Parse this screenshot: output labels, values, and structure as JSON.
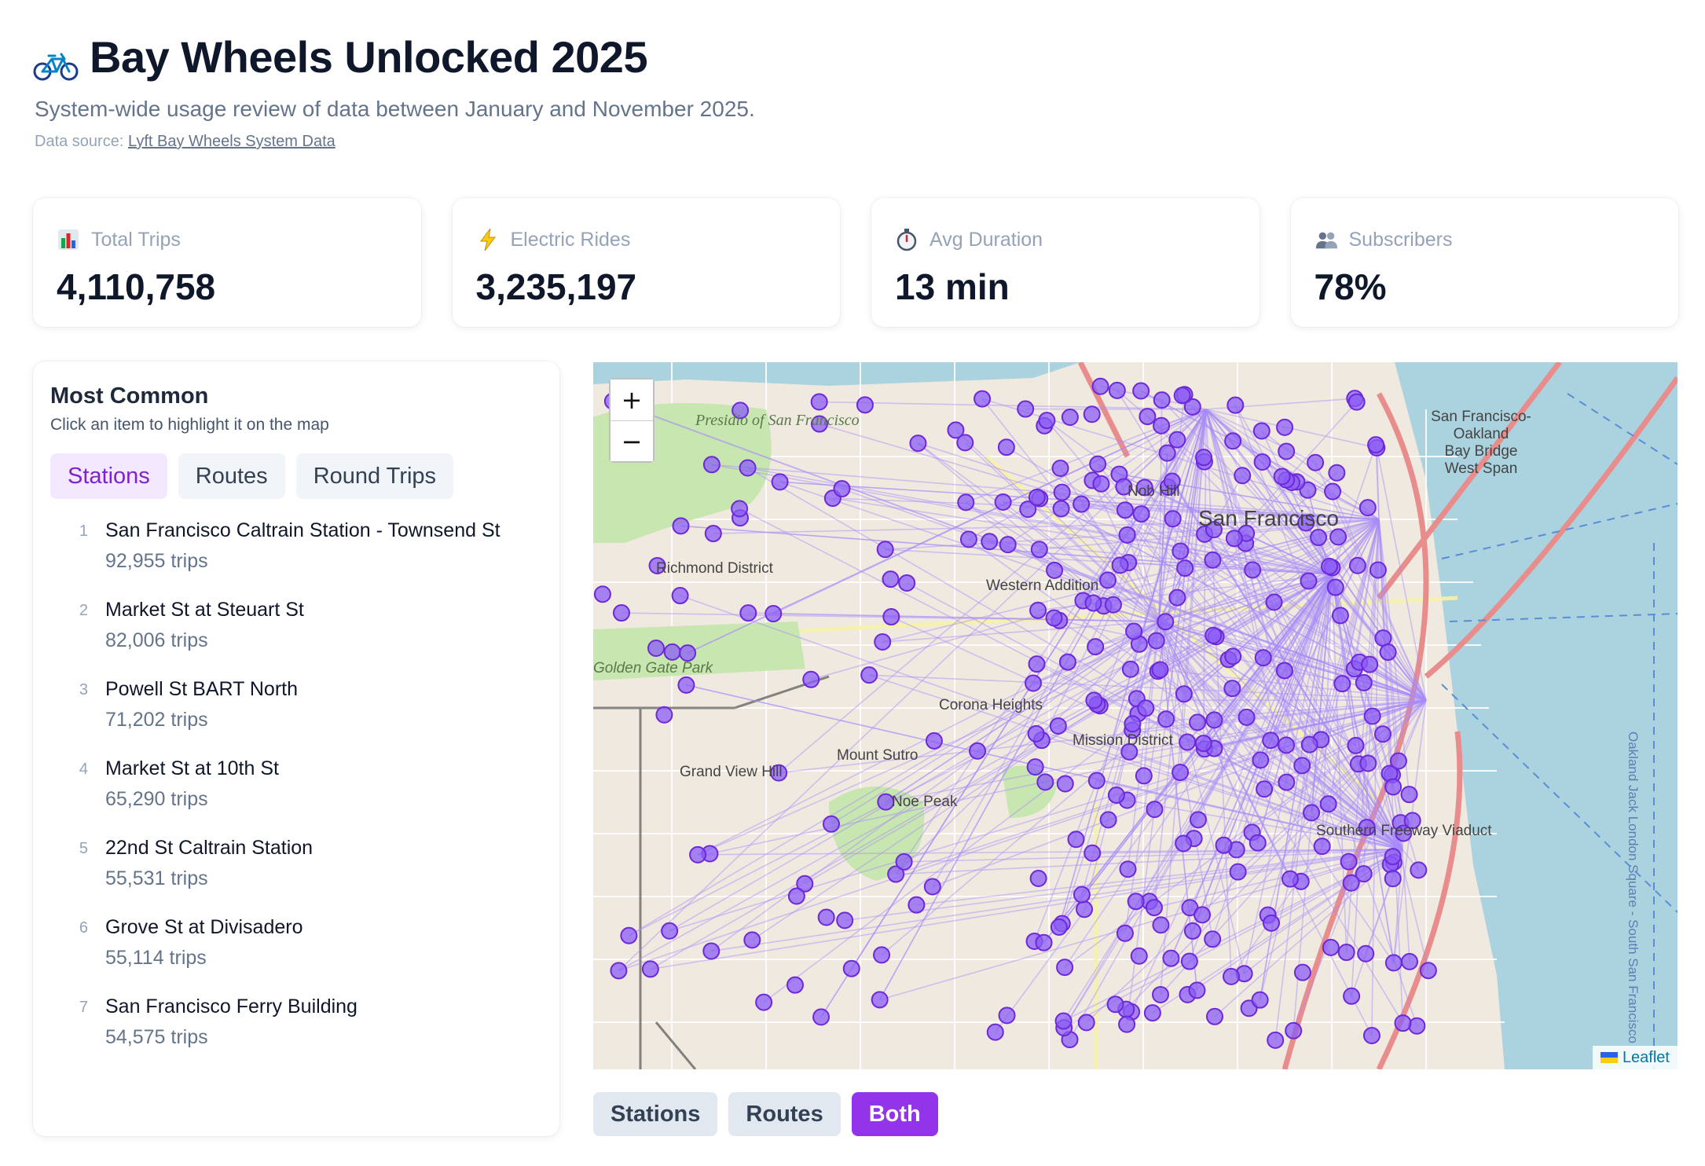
{
  "header": {
    "title": "Bay Wheels Unlocked 2025",
    "subtitle": "System-wide usage review of data between January and November 2025.",
    "source_prefix": "Data source: ",
    "source_link": "Lyft Bay Wheels System Data"
  },
  "kpis": [
    {
      "label": "Total Trips",
      "value": "4,110,758",
      "icon": "bar-chart-icon"
    },
    {
      "label": "Electric Rides",
      "value": "3,235,197",
      "icon": "lightning-icon"
    },
    {
      "label": "Avg Duration",
      "value": "13 min",
      "icon": "stopwatch-icon"
    },
    {
      "label": "Subscribers",
      "value": "78%",
      "icon": "users-icon"
    }
  ],
  "panel": {
    "title": "Most Common",
    "hint": "Click an item to highlight it on the map",
    "tabs": [
      "Stations",
      "Routes",
      "Round Trips"
    ],
    "active_tab": "Stations",
    "items": [
      {
        "rank": "1",
        "name": "San Francisco Caltrain Station - Townsend St",
        "trips": "92,955 trips"
      },
      {
        "rank": "2",
        "name": "Market St at Steuart St",
        "trips": "82,006 trips"
      },
      {
        "rank": "3",
        "name": "Powell St BART North",
        "trips": "71,202 trips"
      },
      {
        "rank": "4",
        "name": "Market St at 10th St",
        "trips": "65,290 trips"
      },
      {
        "rank": "5",
        "name": "22nd St Caltrain Station",
        "trips": "55,531 trips"
      },
      {
        "rank": "6",
        "name": "Grove St at Divisadero",
        "trips": "55,114 trips"
      },
      {
        "rank": "7",
        "name": "San Francisco Ferry Building",
        "trips": "54,575 trips"
      }
    ]
  },
  "map": {
    "zoom_in": "+",
    "zoom_out": "−",
    "attribution": "Leaflet",
    "labels": {
      "presidio": "Presidio of San Francisco",
      "bay_bridge": "San Francisco-Oakland Bay Bridge West Span",
      "richmond": "Richmond District",
      "western_addition": "Western Addition",
      "mission": "Mission District",
      "sf": "San Francisco",
      "golden_gate_park": "Golden Gate Park",
      "oakland_jls": "Oakland Jack London Square - South San Francisco",
      "southern_freeway": "Southern Freeway Viaduct",
      "nob_hill": "Nob Hill",
      "corona_heights": "Corona Heights",
      "twin_peaks": "Mount Sutro",
      "noe_peak": "Noe Peak",
      "grand_view": "Grand View Hill"
    },
    "colors": {
      "station": "#8b5cf6",
      "station_stroke": "#6d28d9",
      "route": "#a78bfa",
      "water": "#aad3df",
      "park": "#c8e6b0"
    }
  },
  "layers": {
    "options": [
      "Stations",
      "Routes",
      "Both"
    ],
    "active": "Both"
  }
}
